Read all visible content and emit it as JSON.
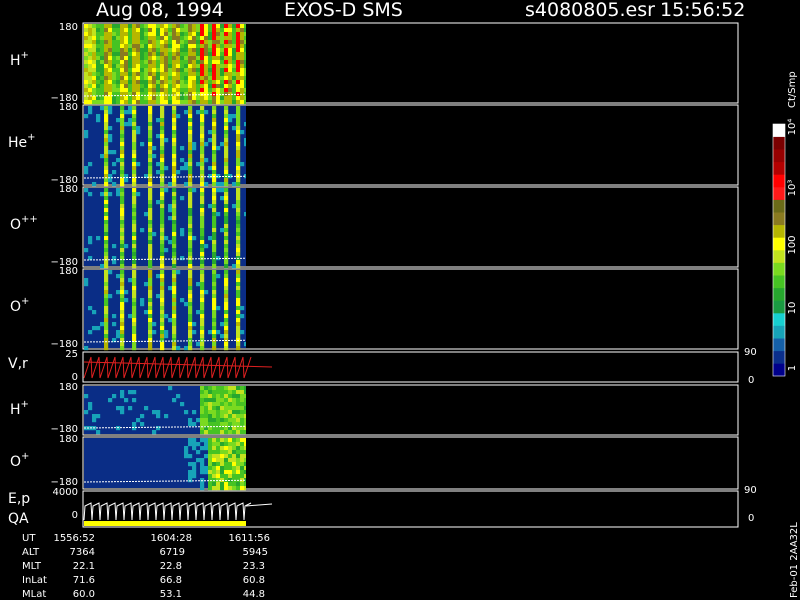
{
  "header": {
    "date": "Aug 08, 1994",
    "instrument": "EXOS-D SMS",
    "file": "s4080805.esr",
    "time": "15:56:52"
  },
  "colors": {
    "panel_bg": "#000000",
    "spectro_bg": "#0a2d86",
    "frame": "#ffffff",
    "velocity_trace": "#e02020",
    "qa_bar": "#ffff00"
  },
  "colorbar": {
    "unit": "Ct/Smp",
    "tick_labels": [
      "1",
      "10",
      "100",
      "10³",
      "10⁴"
    ],
    "colors": [
      "#00008b",
      "#0b2f8c",
      "#1560a8",
      "#17a3b8",
      "#17d0d0",
      "#1a9a42",
      "#27a72e",
      "#46c323",
      "#7ada20",
      "#c2e31e",
      "#ffff00",
      "#b6b600",
      "#8a7a20",
      "#6b6a18",
      "#ff1a1a",
      "#ff0000",
      "#b30000",
      "#960000",
      "#7a0000",
      "#ffffff"
    ]
  },
  "panels": {
    "H_plus_1": {
      "label": "H",
      "sup": "+",
      "ymax": "180",
      "ymin": "−180"
    },
    "He_plus": {
      "label": "He",
      "sup": "+",
      "ymax": "180",
      "ymin": "−180"
    },
    "O_plusplus": {
      "label": "O",
      "sup": "++",
      "ymax": "180",
      "ymin": "−180"
    },
    "O_plus_1": {
      "label": "O",
      "sup": "+",
      "ymax": "180",
      "ymin": "−180"
    },
    "Vr": {
      "label": "V,r",
      "ymax": "25",
      "ymin": "0",
      "right_top": "90",
      "right_bottom": "0"
    },
    "H_plus_2": {
      "label": "H",
      "sup": "+",
      "ymax": "180",
      "ymin": "−180"
    },
    "O_plus_2": {
      "label": "O",
      "sup": "+",
      "ymax": "180",
      "ymin": "−180"
    },
    "Ep": {
      "label": "E,p",
      "label2": "QA",
      "ymax": "4000",
      "ymin": "0",
      "right_top": "90",
      "right_bottom": "0"
    }
  },
  "footer": {
    "rows": [
      {
        "name": "UT",
        "values": [
          "1556:52",
          "1604:28",
          "1611:56"
        ]
      },
      {
        "name": "ALT",
        "values": [
          "7364",
          "6719",
          "5945"
        ]
      },
      {
        "name": "MLT",
        "values": [
          "22.1",
          "22.8",
          "23.3"
        ]
      },
      {
        "name": "InLat",
        "values": [
          "71.6",
          "66.8",
          "60.8"
        ]
      },
      {
        "name": "MLat",
        "values": [
          "60.0",
          "53.1",
          "44.8"
        ]
      }
    ],
    "stamp": "Feb-01 2AA32L"
  },
  "chart_data": [
    {
      "type": "heatmap",
      "panel": "H+",
      "ylim": [
        -180,
        180
      ],
      "yticks": [
        "180",
        "−180"
      ]
    },
    {
      "type": "heatmap",
      "panel": "He+",
      "ylim": [
        -180,
        180
      ],
      "yticks": [
        "180",
        "−180"
      ]
    },
    {
      "type": "heatmap",
      "panel": "O++",
      "ylim": [
        -180,
        180
      ],
      "yticks": [
        "180",
        "−180"
      ]
    },
    {
      "type": "heatmap",
      "panel": "O+",
      "ylim": [
        -180,
        180
      ],
      "yticks": [
        "180",
        "−180"
      ]
    },
    {
      "type": "line",
      "panel": "V,r",
      "ylim": [
        0,
        25
      ],
      "yticks": [
        "25",
        "0"
      ],
      "right_ticks": [
        "90",
        "0"
      ]
    },
    {
      "type": "heatmap",
      "panel": "H+",
      "ylim": [
        -180,
        180
      ],
      "yticks": [
        "180",
        "−180"
      ]
    },
    {
      "type": "heatmap",
      "panel": "O+",
      "ylim": [
        -180,
        180
      ],
      "yticks": [
        "180",
        "−180"
      ]
    },
    {
      "type": "line",
      "panel": "E,p / QA",
      "ylim": [
        0,
        4000
      ],
      "yticks": [
        "4000",
        "0"
      ],
      "right_ticks": [
        "90",
        "0"
      ]
    }
  ]
}
